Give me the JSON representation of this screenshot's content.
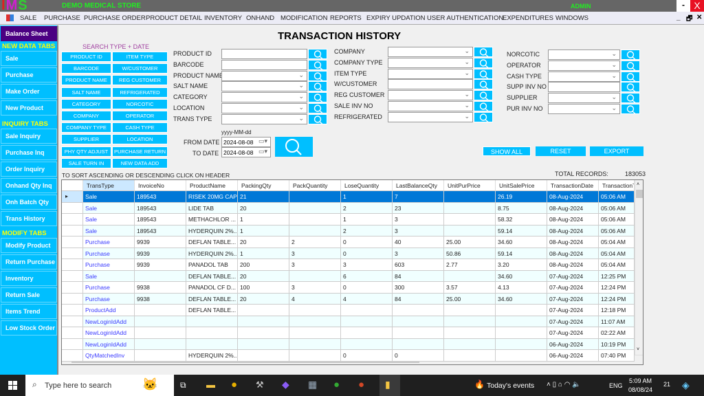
{
  "app": {
    "logo": "IMS",
    "store_name": "DEMO MEDICAL STORE",
    "user": "ADMIN",
    "minimize": "-",
    "close": "X"
  },
  "menu": [
    "SALE",
    "PURCHASE",
    "PURCHASE ORDER",
    "PRODUCT DETAIL",
    "INVENTORY",
    "ONHAND",
    "MODIFICATION",
    "REPORTS",
    "EXPIRY UPDATION",
    "USER AUTHENTICATION",
    "EXPENDITURES",
    "WINDOWS"
  ],
  "mdi_controls": [
    "_",
    "🗗",
    "✕"
  ],
  "sidebar": {
    "balance_sheet": "Balance Sheet",
    "sections": [
      {
        "title": "NEW DATA TABS",
        "items": [
          "Sale",
          "Purchase",
          "Make Order",
          "New Product"
        ]
      },
      {
        "title": "INQUIRY TABS",
        "items": [
          "Sale Inquiry",
          "Purchase Inq",
          "Order Inquiry",
          "Onhand Qty Inq",
          "Onh Batch Qty",
          "Trans History"
        ]
      },
      {
        "title": "MODIFY TABS",
        "items": [
          "Modify Product",
          "Return Purchase",
          "Inventory",
          "Return Sale",
          "Items Trend",
          "Low Stock Order"
        ]
      }
    ]
  },
  "page_title": "TRANSACTION HISTORY",
  "search_type": {
    "title": "SEARCH TYPE + DATE",
    "buttons": [
      "PRODUCT ID",
      "ITEM TYPE",
      "BARCODE",
      "W/CUSTOMER",
      "PRODUCT NAME",
      "REG CUSTOMER",
      "SALT NAME",
      "REFRIGERATED",
      "CATEGORY",
      "NORCOTIC",
      "COMPANY",
      "OPERATOR",
      "COMPANY TYPE",
      "CASH TYPE",
      "SUPPLIER",
      "LOCATION",
      "PHY QTY ADJUST",
      "PURCHASE RETURN",
      "SALE TURN IN",
      "NEW DATA ADD"
    ]
  },
  "filters": {
    "col1": [
      {
        "label": "PRODUCT ID",
        "dropdown": false
      },
      {
        "label": "BARCODE",
        "dropdown": false
      },
      {
        "label": "PRODUCT NAME",
        "dropdown": true
      },
      {
        "label": "SALT NAME",
        "dropdown": true
      },
      {
        "label": "CATEGORY",
        "dropdown": true
      },
      {
        "label": "LOCATION",
        "dropdown": true
      },
      {
        "label": "TRANS TYPE",
        "dropdown": true
      }
    ],
    "col2": [
      {
        "label": "COMPANY",
        "dropdown": true
      },
      {
        "label": "COMPANY TYPE",
        "dropdown": true
      },
      {
        "label": "ITEM TYPE",
        "dropdown": true
      },
      {
        "label": "W/CUSTOMER",
        "dropdown": false
      },
      {
        "label": "REG CUSTOMER",
        "dropdown": true
      },
      {
        "label": "SALE INV NO",
        "dropdown": true
      },
      {
        "label": "REFRIGERATED",
        "dropdown": true
      }
    ],
    "col3": [
      {
        "label": "NORCOTIC",
        "dropdown": true
      },
      {
        "label": "OPERATOR",
        "dropdown": true
      },
      {
        "label": "CASH TYPE",
        "dropdown": true
      },
      {
        "label": "SUPP INV NO",
        "dropdown": false
      },
      {
        "label": "SUPPLIER",
        "dropdown": true
      },
      {
        "label": "PUR INV NO",
        "dropdown": true
      }
    ]
  },
  "dates": {
    "format_hint": "yyyy-MM-dd",
    "from_label": "FROM DATE",
    "from_value": "2024-08-08",
    "to_label": "TO DATE",
    "to_value": "2024-08-08"
  },
  "actions": {
    "show_all": "SHOW ALL",
    "reset": "RESET",
    "export": "EXPORT"
  },
  "total_records": {
    "label": "TOTAL RECORDS:",
    "value": "183053"
  },
  "sort_hint": "TO SORT ASCENDING OR DESCENDING CLICK ON HEADER",
  "grid": {
    "columns": [
      "TransType",
      "InvoiceNo",
      "ProductName",
      "PackingQty",
      "PackQuantity",
      "LoseQuantity",
      "LastBalanceQty",
      "UnitPurPrice",
      "UnitSalePrice",
      "TransactionDate",
      "TransactionT"
    ],
    "selected_row": 0,
    "rows": [
      [
        "Sale",
        "189543",
        "RISEK 20MG CAP",
        "21",
        "",
        "1",
        "7",
        "",
        "26.19",
        "08-Aug-2024",
        "05:06 AM"
      ],
      [
        "Sale",
        "189543",
        "LIDE TAB",
        "20",
        "",
        "2",
        "23",
        "",
        "8.75",
        "08-Aug-2024",
        "05:06 AM"
      ],
      [
        "Sale",
        "189543",
        "METHACHLOR ...",
        "1",
        "",
        "1",
        "3",
        "",
        "58.32",
        "08-Aug-2024",
        "05:06 AM"
      ],
      [
        "Sale",
        "189543",
        "HYDERQUIN 2%...",
        "1",
        "",
        "2",
        "3",
        "",
        "59.14",
        "08-Aug-2024",
        "05:06 AM"
      ],
      [
        "Purchase",
        "9939",
        "DEFLAN TABLE...",
        "20",
        "2",
        "0",
        "40",
        "25.00",
        "34.60",
        "08-Aug-2024",
        "05:04 AM"
      ],
      [
        "Purchase",
        "9939",
        "HYDERQUIN 2%...",
        "1",
        "3",
        "0",
        "3",
        "50.86",
        "59.14",
        "08-Aug-2024",
        "05:04 AM"
      ],
      [
        "Purchase",
        "9939",
        "PANADOL TAB",
        "200",
        "3",
        "3",
        "603",
        "2.77",
        "3.20",
        "08-Aug-2024",
        "05:04 AM"
      ],
      [
        "Sale",
        "",
        "DEFLAN TABLE...",
        "20",
        "",
        "6",
        "84",
        "",
        "34.60",
        "07-Aug-2024",
        "12:25 PM"
      ],
      [
        "Purchase",
        "9938",
        "PANADOL CF D...",
        "100",
        "3",
        "0",
        "300",
        "3.57",
        "4.13",
        "07-Aug-2024",
        "12:24 PM"
      ],
      [
        "Purchase",
        "9938",
        "DEFLAN TABLE...",
        "20",
        "4",
        "4",
        "84",
        "25.00",
        "34.60",
        "07-Aug-2024",
        "12:24 PM"
      ],
      [
        "ProductAdd",
        "",
        "DEFLAN TABLE...",
        "",
        "",
        "",
        "",
        "",
        "",
        "07-Aug-2024",
        "12:18 PM"
      ],
      [
        "NewLoginIdAdd",
        "",
        "",
        "",
        "",
        "",
        "",
        "",
        "",
        "07-Aug-2024",
        "11:07 AM"
      ],
      [
        "NewLoginIdAdd",
        "",
        "",
        "",
        "",
        "",
        "",
        "",
        "",
        "07-Aug-2024",
        "02:22 AM"
      ],
      [
        "NewLoginIdAdd",
        "",
        "",
        "",
        "",
        "",
        "",
        "",
        "",
        "06-Aug-2024",
        "10:19 PM"
      ],
      [
        "QtyMatchedInv",
        "",
        "HYDERQUIN 2%...",
        "",
        "",
        "0",
        "0",
        "",
        "",
        "06-Aug-2024",
        "07:40 PM"
      ]
    ]
  },
  "taskbar": {
    "search_placeholder": "Type here to search",
    "events": "Today's events",
    "lang": "ENG",
    "time": "5:09 AM",
    "date": "08/08/24",
    "notifications": "21"
  },
  "colors": {
    "accent": "#00bfff",
    "balance_sheet": "#4b0082",
    "section_header": "#ffff00",
    "selected_row": "#0078d7",
    "alt_row": "#f0ffff",
    "trans_type_text": "#3a3aff"
  }
}
